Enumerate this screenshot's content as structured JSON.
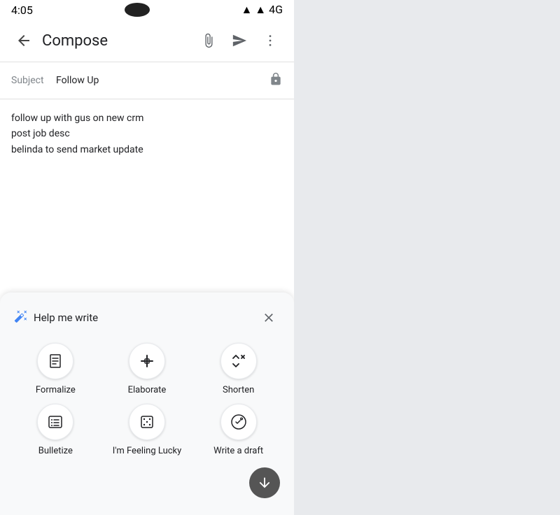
{
  "statusBar": {
    "leftText": "4:05",
    "rightText": "▲ ▲ 4G"
  },
  "header": {
    "title": "Compose",
    "backLabel": "←",
    "attachIcon": "attach-icon",
    "sendIcon": "send-icon",
    "moreIcon": "more-icon"
  },
  "subject": {
    "label": "Subject",
    "value": "Follow Up"
  },
  "body": {
    "line1": "follow up with gus on new crm",
    "line2": "post job desc",
    "line3": "belinda to send market update"
  },
  "helpPanel": {
    "title": "Help me write",
    "actions": [
      {
        "id": "formalize",
        "label": "Formalize"
      },
      {
        "id": "elaborate",
        "label": "Elaborate"
      },
      {
        "id": "shorten",
        "label": "Shorten"
      },
      {
        "id": "bulletize",
        "label": "Bulletize"
      },
      {
        "id": "feeling-lucky",
        "label": "I'm Feeling Lucky"
      },
      {
        "id": "write-draft",
        "label": "Write a draft"
      }
    ],
    "closeLabel": "×",
    "scrollDownLabel": "↓"
  }
}
